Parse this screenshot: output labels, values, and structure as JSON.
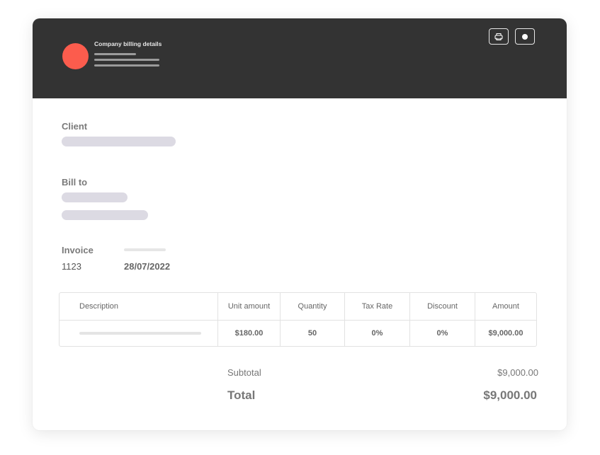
{
  "header": {
    "company_title": "Company billing details",
    "background_color": "#333333",
    "logo_color": "#fc5c4d",
    "print_button_icon": "printer-icon",
    "record_button_icon": "record-dot-icon"
  },
  "client": {
    "label": "Client"
  },
  "bill_to": {
    "label": "Bill to"
  },
  "invoice": {
    "label": "Invoice",
    "number": "1123",
    "date": "28/07/2022"
  },
  "table": {
    "headers": [
      "Description",
      "Unit amount",
      "Quantity",
      "Tax Rate",
      "Discount",
      "Amount"
    ],
    "rows": [
      {
        "description": "",
        "unit_amount": "$180.00",
        "quantity": "50",
        "tax_rate": "0%",
        "discount": "0%",
        "amount": "$9,000.00"
      }
    ]
  },
  "totals": {
    "subtotal_label": "Subtotal",
    "subtotal_value": "$9,000.00",
    "total_label": "Total",
    "total_value": "$9,000.00"
  }
}
